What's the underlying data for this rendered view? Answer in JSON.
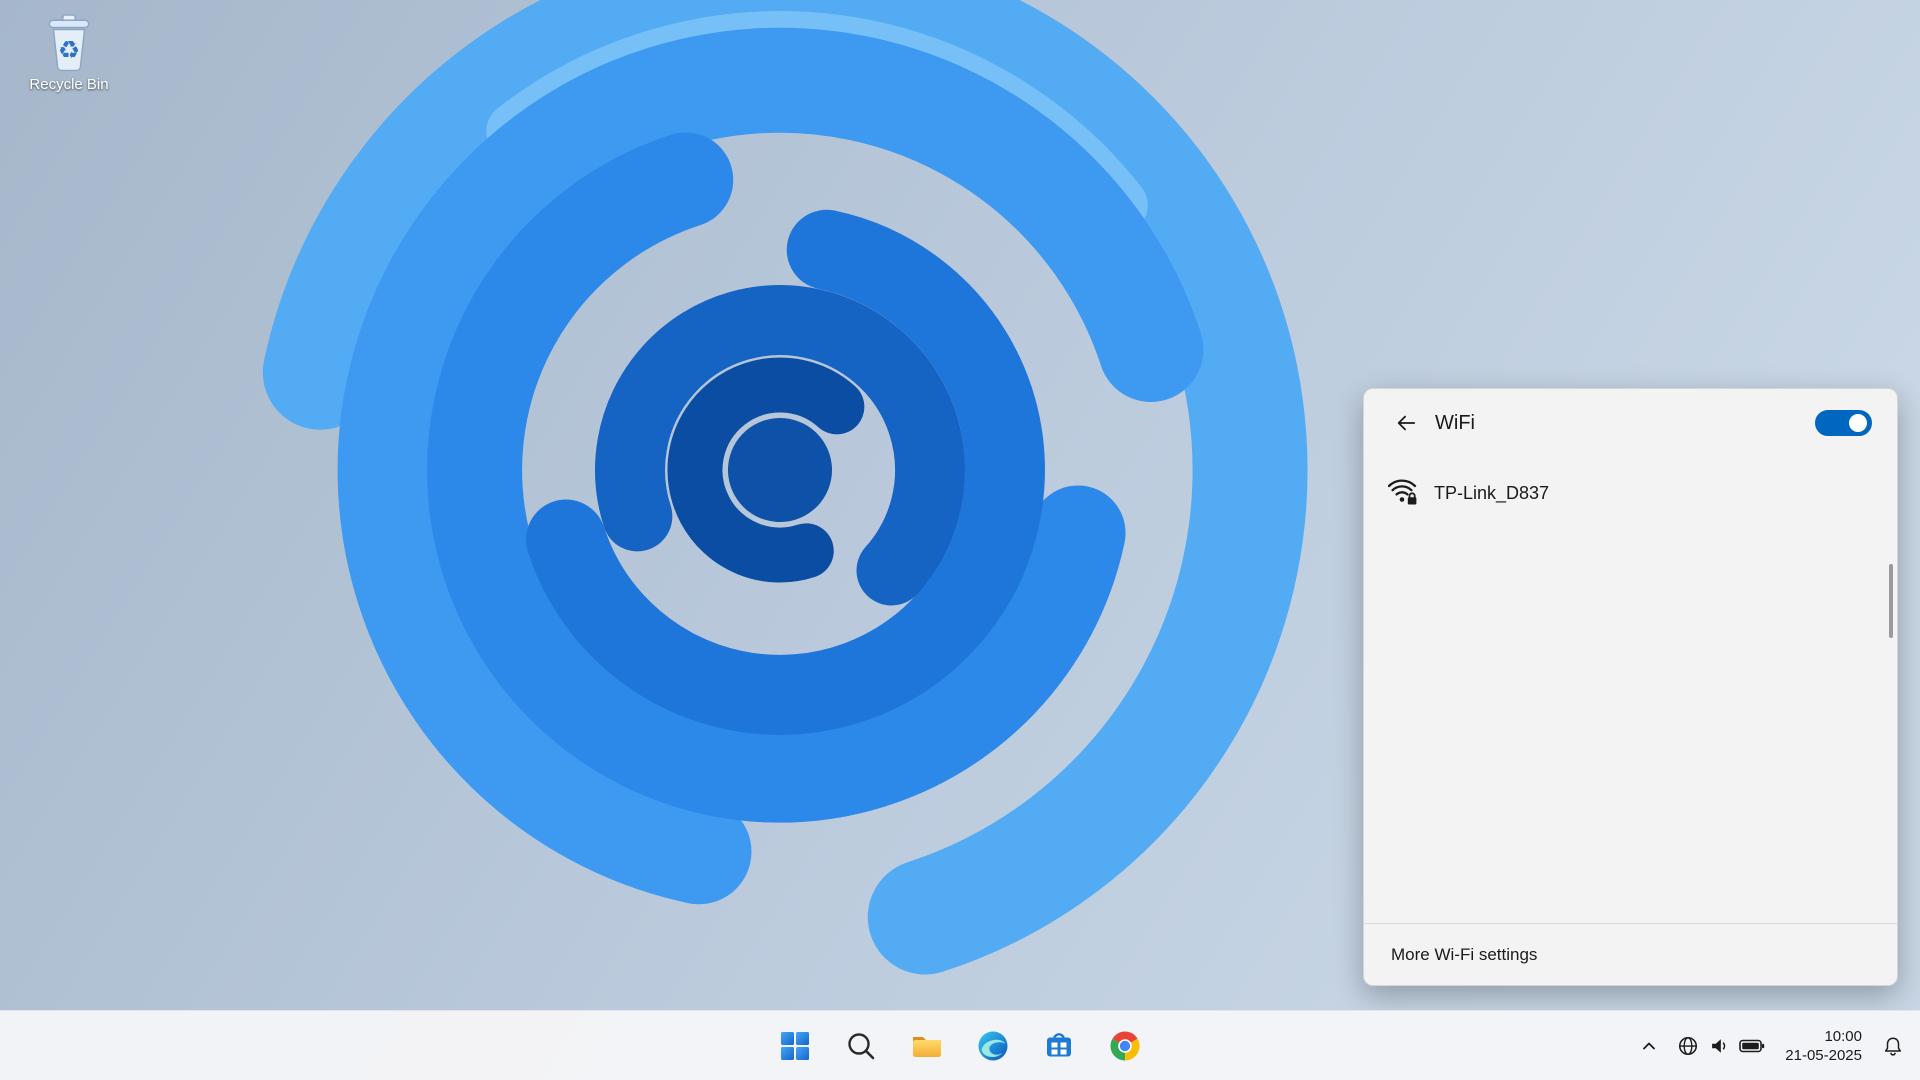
{
  "desktop": {
    "recycle_bin": {
      "label": "Recycle Bin"
    }
  },
  "wifi_panel": {
    "title": "WiFi",
    "toggle": {
      "state": "on",
      "accent_color": "#0067c0"
    },
    "networks": [
      {
        "name": "TP-Link_D837",
        "secured": true,
        "icon": "wifi-secured-icon"
      }
    ],
    "footer": {
      "more_settings_label": "More Wi-Fi settings"
    }
  },
  "taskbar": {
    "buttons": [
      {
        "icon": "start-icon"
      },
      {
        "icon": "search-icon"
      },
      {
        "icon": "file-explorer-icon"
      },
      {
        "icon": "edge-icon"
      },
      {
        "icon": "microsoft-store-icon"
      },
      {
        "icon": "chrome-icon"
      }
    ],
    "tray": {
      "icons": [
        "chevron-up-icon",
        "globe-network-icon",
        "speaker-icon",
        "battery-icon",
        "bell-icon"
      ],
      "clock": {
        "time": "10:00",
        "date": "21-05-2025"
      }
    }
  },
  "colors": {
    "accent": "#0067c0",
    "panel_bg": "#f3f3f3",
    "taskbar_bg": "#f5f6f8",
    "wallpaper_blues": [
      "#0b4da3",
      "#1563c2",
      "#1f76da",
      "#2c88e9",
      "#3d9af0",
      "#53abf4"
    ]
  }
}
